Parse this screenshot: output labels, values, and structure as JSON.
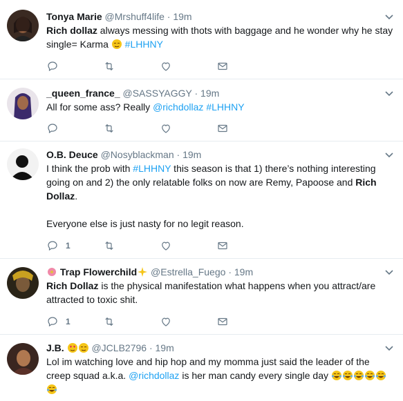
{
  "tweets": [
    {
      "name": "Tonya Marie",
      "handle": "@Mrshuff4life",
      "dot": "·",
      "time": "19m",
      "lines": [
        {
          "parts": [
            {
              "t": "Rich dollaz",
              "s": "bold"
            },
            {
              "t": " always messing with thots with baggage and he wonder why he stay single= Karma ",
              "s": "plain"
            },
            {
              "t": "relieved-face-emoji",
              "s": "emoji"
            },
            {
              "t": " ",
              "s": "plain"
            },
            {
              "t": "#LHHNY",
              "s": "link"
            }
          ]
        }
      ],
      "reply_count": "",
      "avatar_icon": "profile-photo"
    },
    {
      "name": "_queen_france_",
      "handle": "@SASSYAGGY",
      "dot": "·",
      "time": "19m",
      "lines": [
        {
          "parts": [
            {
              "t": "All for some ass? Really ",
              "s": "plain"
            },
            {
              "t": "@richdollaz",
              "s": "link"
            },
            {
              "t": " ",
              "s": "plain"
            },
            {
              "t": "#LHHNY",
              "s": "link"
            }
          ]
        }
      ],
      "reply_count": "",
      "avatar_icon": "profile-photo"
    },
    {
      "name": "O.B. Deuce",
      "handle": "@Nosyblackman",
      "dot": "·",
      "time": "19m",
      "lines": [
        {
          "parts": [
            {
              "t": "I think the prob with ",
              "s": "plain"
            },
            {
              "t": "#LHHNY",
              "s": "link"
            },
            {
              "t": " this season is that 1) there’s nothing interesting going on and 2) the only relatable folks on now are Remy, Papoose and ",
              "s": "plain"
            },
            {
              "t": "Rich Dollaz",
              "s": "bold"
            },
            {
              "t": ".",
              "s": "plain"
            }
          ]
        },
        {
          "parts": [
            {
              "t": "Everyone else is just nasty for no legit reason.",
              "s": "plain"
            }
          ]
        }
      ],
      "reply_count": "1",
      "avatar_icon": "profile-photo"
    },
    {
      "name": "Trap Flowerchild",
      "handle": "@Estrella_Fuego",
      "dot": "·",
      "time": "19m",
      "lines": [
        {
          "parts": [
            {
              "t": "Rich Dollaz",
              "s": "bold"
            },
            {
              "t": " is the physical manifestation what happens when you attract/are attracted to toxic shit.",
              "s": "plain"
            }
          ]
        }
      ],
      "reply_count": "1",
      "avatar_icon": "profile-photo"
    },
    {
      "name": "J.B.",
      "handle": "@JCLB2796",
      "dot": "·",
      "time": "19m",
      "lines": [
        {
          "parts": [
            {
              "t": "Lol im watching love and hip hop and my momma just said the leader of the creep squad a.k.a. ",
              "s": "plain"
            },
            {
              "t": "@richdollaz",
              "s": "link"
            },
            {
              "t": " is her man candy every single day ",
              "s": "plain"
            },
            {
              "t": "tears-of-joy-emoji",
              "s": "emoji"
            },
            {
              "t": "tears-of-joy-emoji",
              "s": "emoji"
            },
            {
              "t": "tears-of-joy-emoji",
              "s": "emoji"
            },
            {
              "t": "tears-of-joy-emoji",
              "s": "emoji"
            },
            {
              "t": "tears-of-joy-emoji",
              "s": "emoji"
            },
            {
              "t": "tears-of-joy-emoji",
              "s": "emoji"
            }
          ]
        }
      ],
      "reply_count": "",
      "avatar_icon": "profile-photo"
    }
  ],
  "icons": {
    "reply": "reply-icon",
    "retweet": "retweet-icon",
    "like": "heart-icon",
    "dm": "envelope-icon",
    "caret": "chevron-down-icon"
  },
  "colors": {
    "link": "#1da1f2",
    "muted": "#657786",
    "text": "#14171a",
    "divider": "#e6ecf0"
  }
}
